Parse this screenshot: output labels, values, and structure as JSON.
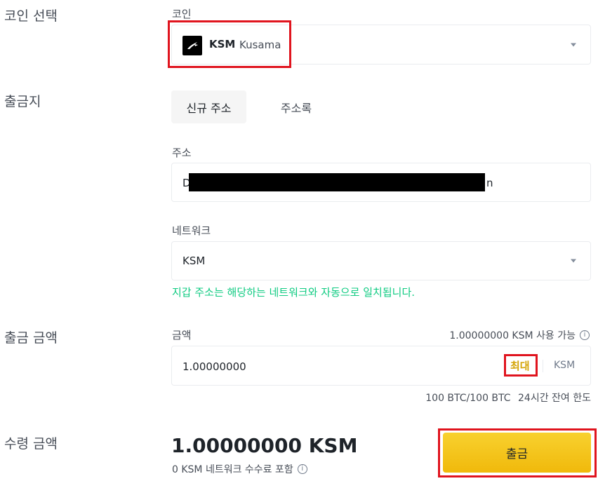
{
  "coin_select": {
    "section_label": "코인 선택",
    "field_label": "코인",
    "selected_symbol": "KSM",
    "selected_name": "Kusama",
    "icon": "kusama-bird-icon"
  },
  "destination": {
    "section_label": "출금지",
    "tabs": [
      {
        "label": "신규 주소",
        "active": true
      },
      {
        "label": "주소록",
        "active": false
      }
    ],
    "address_label": "주소",
    "address_prefix": "D",
    "address_suffix": "n",
    "network_label": "네트워크",
    "network_value": "KSM",
    "network_notice": "지갑 주소는 해당하는 네트워크와 자동으로 일치됩니다."
  },
  "amount": {
    "section_label": "출금 금액",
    "field_label": "금액",
    "available": "1.00000000 KSM 사용 가능",
    "value": "1.00000000",
    "max_label": "최대",
    "unit": "KSM",
    "limit": "100 BTC/100 BTC",
    "limit_label": "24시간 잔여 한도"
  },
  "receive": {
    "section_label": "수령 금액",
    "total": "1.00000000 KSM",
    "fee_note": "0 KSM 네트워크 수수료 포함"
  },
  "withdraw_button": "출금",
  "colors": {
    "accent_yellow": "#f0b90b",
    "notice_green": "#0ecb81",
    "highlight_red": "#e0141e"
  }
}
